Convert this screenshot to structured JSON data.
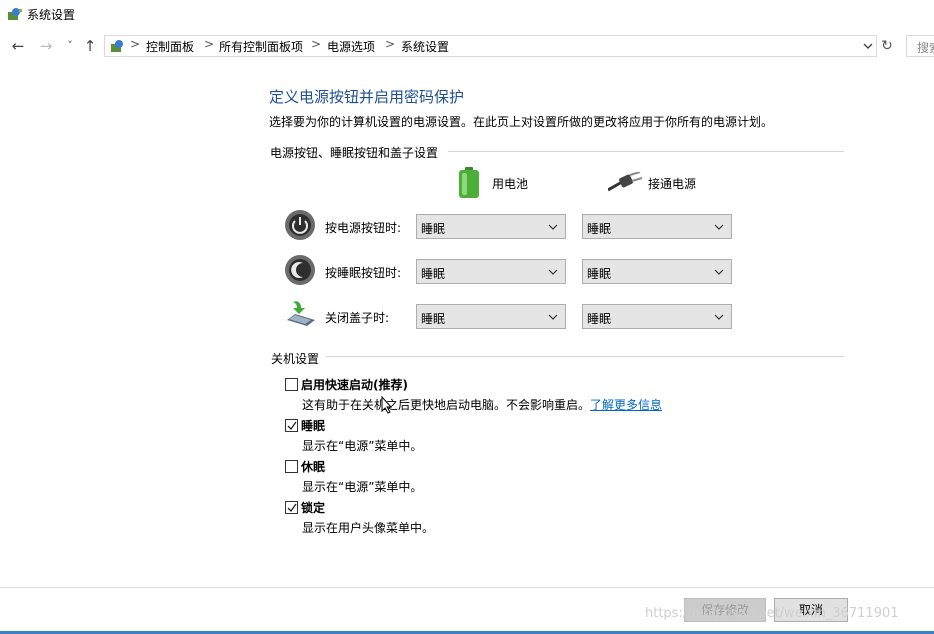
{
  "window": {
    "title": "系统设置",
    "icon": "power-options-icon"
  },
  "nav": {
    "back": "←",
    "forward": "→",
    "history": "˅",
    "up": "↑",
    "refresh": "↻",
    "breadcrumb": [
      "控制面板",
      "所有控制面板项",
      "电源选项",
      "系统设置"
    ],
    "separator": ">",
    "search_placeholder": "搜索"
  },
  "main": {
    "heading": "定义电源按钮并启用密码保护",
    "description": "选择要为你的计算机设置的电源设置。在此页上对设置所做的更改将应用于你所有的电源计划。",
    "buttons_section": {
      "title": "电源按钮、睡眠按钮和盖子设置",
      "col_battery": "用电池",
      "col_plugged": "接通电源",
      "rows": [
        {
          "label": "按电源按钮时:",
          "icon": "power-button-icon",
          "battery": "睡眠",
          "plugged": "睡眠"
        },
        {
          "label": "按睡眠按钮时:",
          "icon": "sleep-button-icon",
          "battery": "睡眠",
          "plugged": "睡眠"
        },
        {
          "label": "关闭盖子时:",
          "icon": "laptop-lid-icon",
          "battery": "睡眠",
          "plugged": "睡眠"
        }
      ]
    },
    "shutdown_section": {
      "title": "关机设置",
      "items": [
        {
          "label": "启用快速启动(推荐)",
          "checked": false,
          "desc": "这有助于在关机之后更快地启动电脑。不会影响重启。",
          "link": "了解更多信息"
        },
        {
          "label": "睡眠",
          "checked": true,
          "desc": "显示在“电源”菜单中。"
        },
        {
          "label": "休眠",
          "checked": false,
          "desc": "显示在“电源”菜单中。"
        },
        {
          "label": "锁定",
          "checked": true,
          "desc": "显示在用户头像菜单中。"
        }
      ]
    }
  },
  "footer": {
    "save": "保存修改",
    "cancel": "取消"
  },
  "watermark": "https://blog.csdn.net/weixin_36711901",
  "colors": {
    "heading": "#1e4f93",
    "link": "#0066cc",
    "accent_bar": "#3c7fc7"
  }
}
